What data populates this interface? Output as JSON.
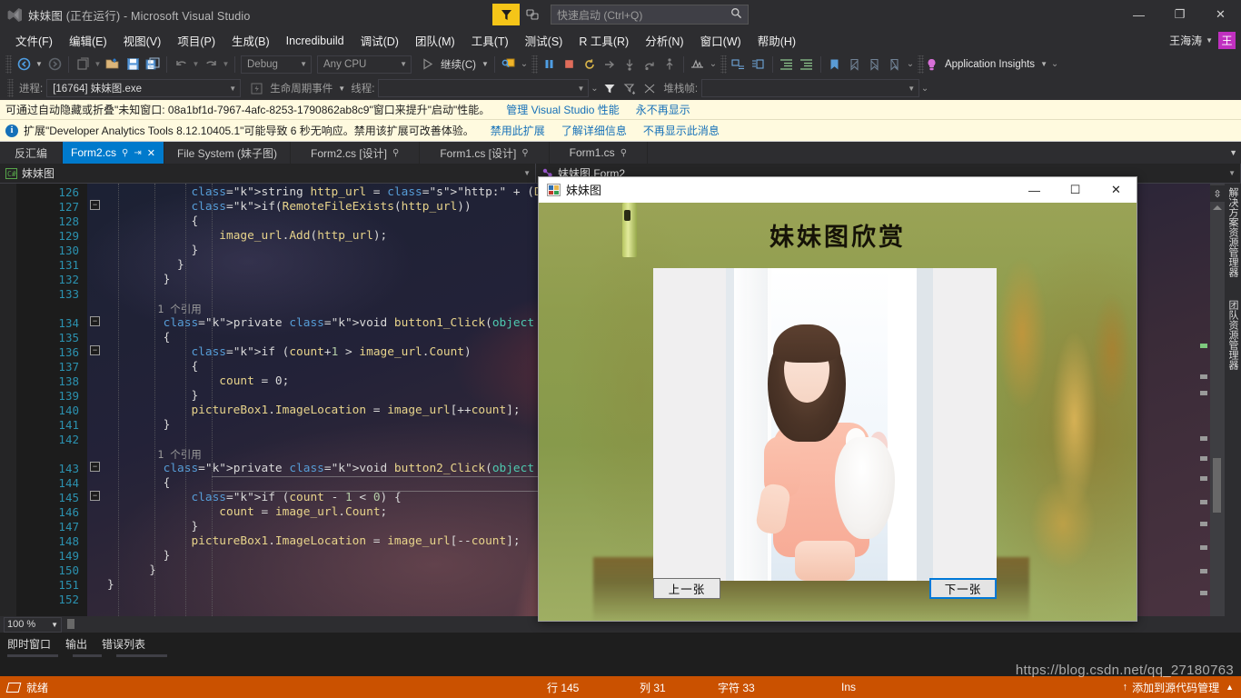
{
  "titlebar": {
    "project": "妹妹图",
    "state": "(正在运行)",
    "app": "- Microsoft Visual Studio",
    "quicklaunch_placeholder": "快速启动 (Ctrl+Q)",
    "feedback_icon": "feedback-flag-icon",
    "minimize": "—",
    "restore": "❐",
    "close": "✕"
  },
  "menu": {
    "items": [
      "文件(F)",
      "编辑(E)",
      "视图(V)",
      "项目(P)",
      "生成(B)",
      "Incredibuild",
      "调试(D)",
      "团队(M)",
      "工具(T)",
      "测试(S)",
      "R 工具(R)",
      "分析(N)",
      "窗口(W)",
      "帮助(H)"
    ],
    "user": "王海涛",
    "avatar_letter": "王"
  },
  "toolbar": {
    "config": "Debug",
    "platform": "Any CPU",
    "continue": "继续(C)",
    "app_insights": "Application Insights",
    "process_label": "进程:",
    "process_value": "[16764] 妹妹图.exe",
    "lifecycle_label": "生命周期事件",
    "thread_label": "线程:",
    "thread_value": "",
    "stackframe_label": "堆栈帧:",
    "stackframe_value": ""
  },
  "infobars": [
    {
      "text": "可通过自动隐藏或折叠\"未知窗口: 08a1bf1d-7967-4afc-8253-1790862ab8c9\"窗口来提升\"启动\"性能。",
      "links": [
        "管理 Visual Studio 性能",
        "永不再显示"
      ],
      "icon": ""
    },
    {
      "text": "扩展\"Developer Analytics Tools 8.12.10405.1\"可能导致 6 秒无响应。禁用该扩展可改善体验。",
      "links": [
        "禁用此扩展",
        "了解详细信息",
        "不再显示此消息"
      ],
      "icon": "info-icon"
    }
  ],
  "tabs": [
    {
      "label": "反汇编",
      "active": false,
      "pin": false,
      "close": false
    },
    {
      "label": "Form2.cs",
      "active": true,
      "pin": true,
      "close": true
    },
    {
      "label": "File System (妹子图)",
      "active": false,
      "pin": false,
      "close": false
    },
    {
      "label": "Form2.cs [设计]",
      "active": false,
      "pin": true,
      "close": false
    },
    {
      "label": "Form1.cs [设计]",
      "active": false,
      "pin": true,
      "close": false
    },
    {
      "label": "Form1.cs",
      "active": false,
      "pin": true,
      "close": false
    }
  ],
  "navbar": {
    "type_icon": "csharp-icon",
    "type_value": "妹妹图",
    "member_icon": "method-icon",
    "member_value": "妹妹图.Form2"
  },
  "code": {
    "first_line_number": 126,
    "lines": [
      {
        "n": 126,
        "text": "            string http_url = \"http:\" + (DecodeBase64(Encoding.U"
      },
      {
        "n": 127,
        "text": "            if(RemoteFileExists(http_url))",
        "fold": true
      },
      {
        "n": 128,
        "text": "            {"
      },
      {
        "n": 129,
        "text": "                image_url.Add(http_url);"
      },
      {
        "n": 130,
        "text": "            }"
      },
      {
        "n": 131,
        "text": "          }"
      },
      {
        "n": 132,
        "text": "        }"
      },
      {
        "n": 133,
        "text": ""
      },
      {
        "n": null,
        "text": "        1 个引用",
        "ref": true
      },
      {
        "n": 134,
        "text": "        private void button1_Click(object sender, EventArgs e)",
        "fold": true
      },
      {
        "n": 135,
        "text": "        {"
      },
      {
        "n": 136,
        "text": "            if (count+1 > image_url.Count)",
        "fold": true
      },
      {
        "n": 137,
        "text": "            {"
      },
      {
        "n": 138,
        "text": "                count = 0;"
      },
      {
        "n": 139,
        "text": "            }"
      },
      {
        "n": 140,
        "text": "            pictureBox1.ImageLocation = image_url[++count];"
      },
      {
        "n": 141,
        "text": "        }"
      },
      {
        "n": 142,
        "text": ""
      },
      {
        "n": null,
        "text": "        1 个引用",
        "ref": true
      },
      {
        "n": 143,
        "text": "        private void button2_Click(object sender, EventArgs e)",
        "fold": true
      },
      {
        "n": 144,
        "text": "        {"
      },
      {
        "n": 145,
        "text": "            if (count - 1 < 0) {",
        "fold": true
      },
      {
        "n": 146,
        "text": "                count = image_url.Count;"
      },
      {
        "n": 147,
        "text": "            }"
      },
      {
        "n": 148,
        "text": "            pictureBox1.ImageLocation = image_url[--count];"
      },
      {
        "n": 149,
        "text": "        }"
      },
      {
        "n": 150,
        "text": "      }"
      },
      {
        "n": 151,
        "text": "}"
      },
      {
        "n": 152,
        "text": ""
      }
    ]
  },
  "vertical_tabs": [
    "解决方案资源管理器",
    "团队资源管理器"
  ],
  "zoom": "100 %",
  "panel_tabs": [
    "即时窗口",
    "输出",
    "错误列表"
  ],
  "statusbar": {
    "ready": "就绪",
    "line_label": "行 145",
    "col_label": "列 31",
    "char_label": "字符 33",
    "insert_mode": "Ins",
    "source_control": "添加到源代码管理",
    "accent": "#ca5100"
  },
  "watermark": "https://blog.csdn.net/qq_27180763",
  "appwindow": {
    "icon": "winform-icon",
    "title": "妹妹图",
    "minimize": "—",
    "maximize": "☐",
    "close": "✕",
    "heading": "妹妹图欣赏",
    "prev_button": "上一张",
    "next_button": "下一张"
  }
}
